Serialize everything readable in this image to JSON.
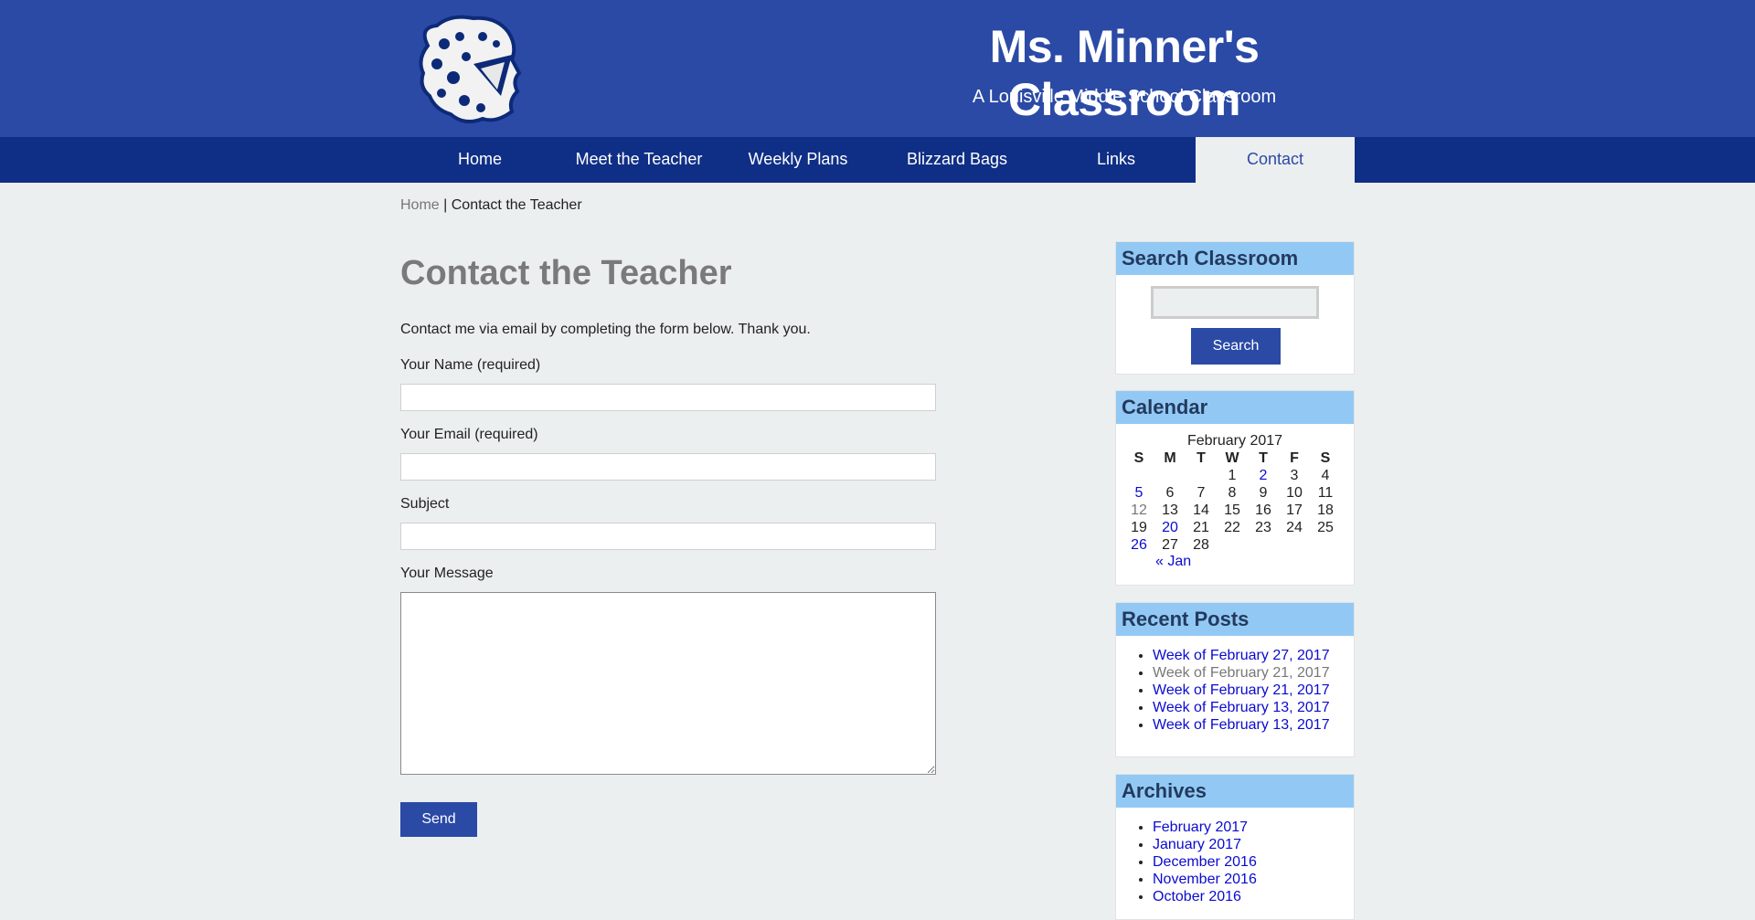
{
  "header": {
    "title": "Ms. Minner's Classroom",
    "tagline": "A Louisville Middle School Classroom"
  },
  "nav": {
    "items": [
      {
        "label": "Home"
      },
      {
        "label": "Meet the Teacher"
      },
      {
        "label": "Weekly Plans"
      },
      {
        "label": "Blizzard Bags"
      },
      {
        "label": "Links"
      },
      {
        "label": "Contact",
        "active": true
      }
    ]
  },
  "breadcrumb": {
    "home": "Home",
    "separator": " | ",
    "current": "Contact the Teacher"
  },
  "page": {
    "title": "Contact the Teacher",
    "intro": "Contact me via email by completing the form below. Thank you."
  },
  "form": {
    "name_label": "Your Name (required)",
    "email_label": "Your Email (required)",
    "subject_label": "Subject",
    "message_label": "Your Message",
    "send_label": "Send"
  },
  "sidebar": {
    "search": {
      "title": "Search Classroom",
      "button": "Search"
    },
    "calendar": {
      "title": "Calendar",
      "caption": "February 2017",
      "weekdays": [
        "S",
        "M",
        "T",
        "W",
        "T",
        "F",
        "S"
      ],
      "weeks": [
        [
          "",
          "",
          "",
          "1",
          "2",
          "3",
          "4"
        ],
        [
          "5",
          "6",
          "7",
          "8",
          "9",
          "10",
          "11"
        ],
        [
          "12",
          "13",
          "14",
          "15",
          "16",
          "17",
          "18"
        ],
        [
          "19",
          "20",
          "21",
          "22",
          "23",
          "24",
          "25"
        ],
        [
          "26",
          "27",
          "28",
          "",
          "",
          "",
          ""
        ]
      ],
      "linked_days": [
        "2",
        "5",
        "20",
        "26"
      ],
      "today": "12",
      "prev": "« Jan"
    },
    "recent_posts": {
      "title": "Recent Posts",
      "items": [
        {
          "label": "Week of February 27, 2017"
        },
        {
          "label": "Week of February 21, 2017",
          "visited": true
        },
        {
          "label": "Week of February 21, 2017"
        },
        {
          "label": "Week of February 13, 2017"
        },
        {
          "label": "Week of February 13, 2017"
        }
      ]
    },
    "archives": {
      "title": "Archives",
      "items": [
        {
          "label": "February 2017"
        },
        {
          "label": "January 2017"
        },
        {
          "label": "December 2016"
        },
        {
          "label": "November 2016"
        },
        {
          "label": "October 2016"
        }
      ]
    }
  },
  "colors": {
    "header_bg": "#2b4aa6",
    "nav_bg": "#0f2f86",
    "widget_title_bg": "#92c9f4",
    "link": "#0a0ad0"
  }
}
